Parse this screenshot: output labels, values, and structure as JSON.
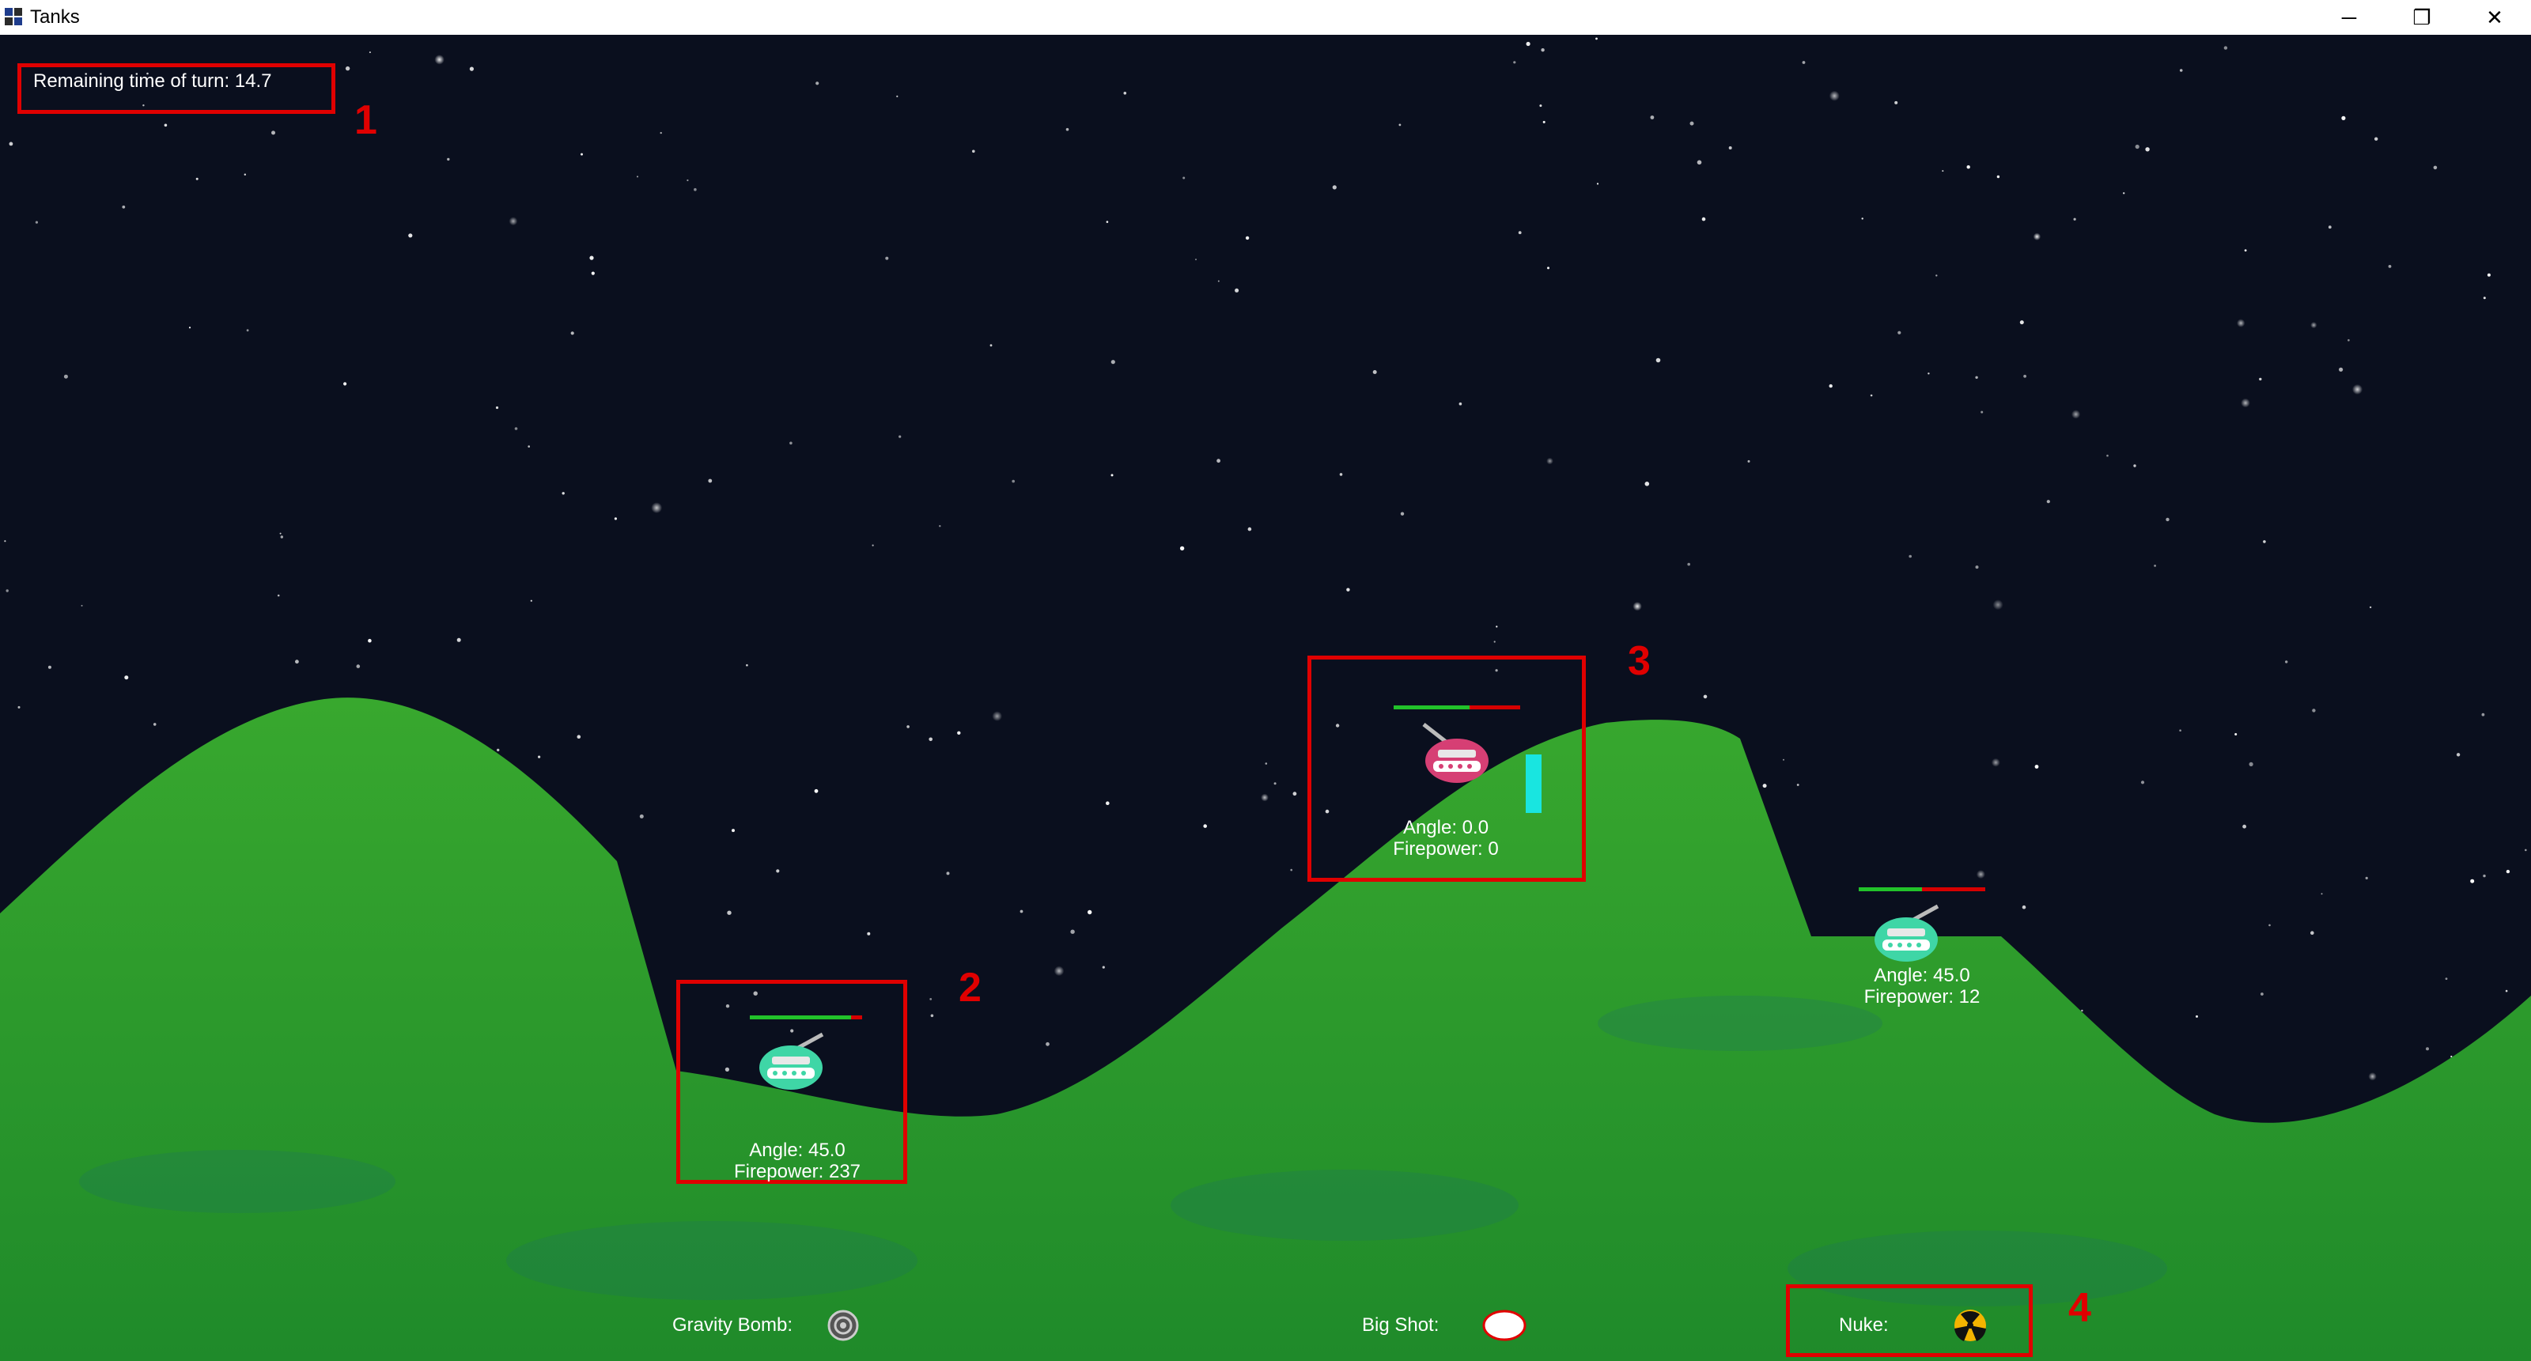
{
  "window": {
    "title": "Tanks",
    "controls": {
      "minimize": "─",
      "restore": "❐",
      "close": "✕"
    }
  },
  "hud": {
    "timer_text": "Remaining time of turn: 14.7"
  },
  "callouts": {
    "one": "1",
    "two": "2",
    "three": "3",
    "four": "4"
  },
  "tanks": [
    {
      "angle_text": "Angle: 45.0",
      "firepower_text": "Firepower: 237",
      "health": 0.9,
      "color": "#3fd6a6"
    },
    {
      "angle_text": "Angle: 0.0",
      "firepower_text": "Firepower: 0",
      "health": 0.6,
      "color": "#d63f74"
    },
    {
      "angle_text": "Angle: 45.0",
      "firepower_text": "Firepower: 12",
      "health": 0.5,
      "color": "#3fd6a6"
    }
  ],
  "weapons": {
    "gravity_bomb": {
      "label": "Gravity Bomb:",
      "icon": "gravity-bomb-icon"
    },
    "big_shot": {
      "label": "Big Shot:",
      "icon": "big-shot-icon"
    },
    "nuke": {
      "label": "Nuke:",
      "icon": "nuke-icon"
    }
  },
  "colors": {
    "sky": "#0a0f1e",
    "terrain": "#2c9a28",
    "highlight": "#e00000",
    "charge": "#19e5e0"
  }
}
